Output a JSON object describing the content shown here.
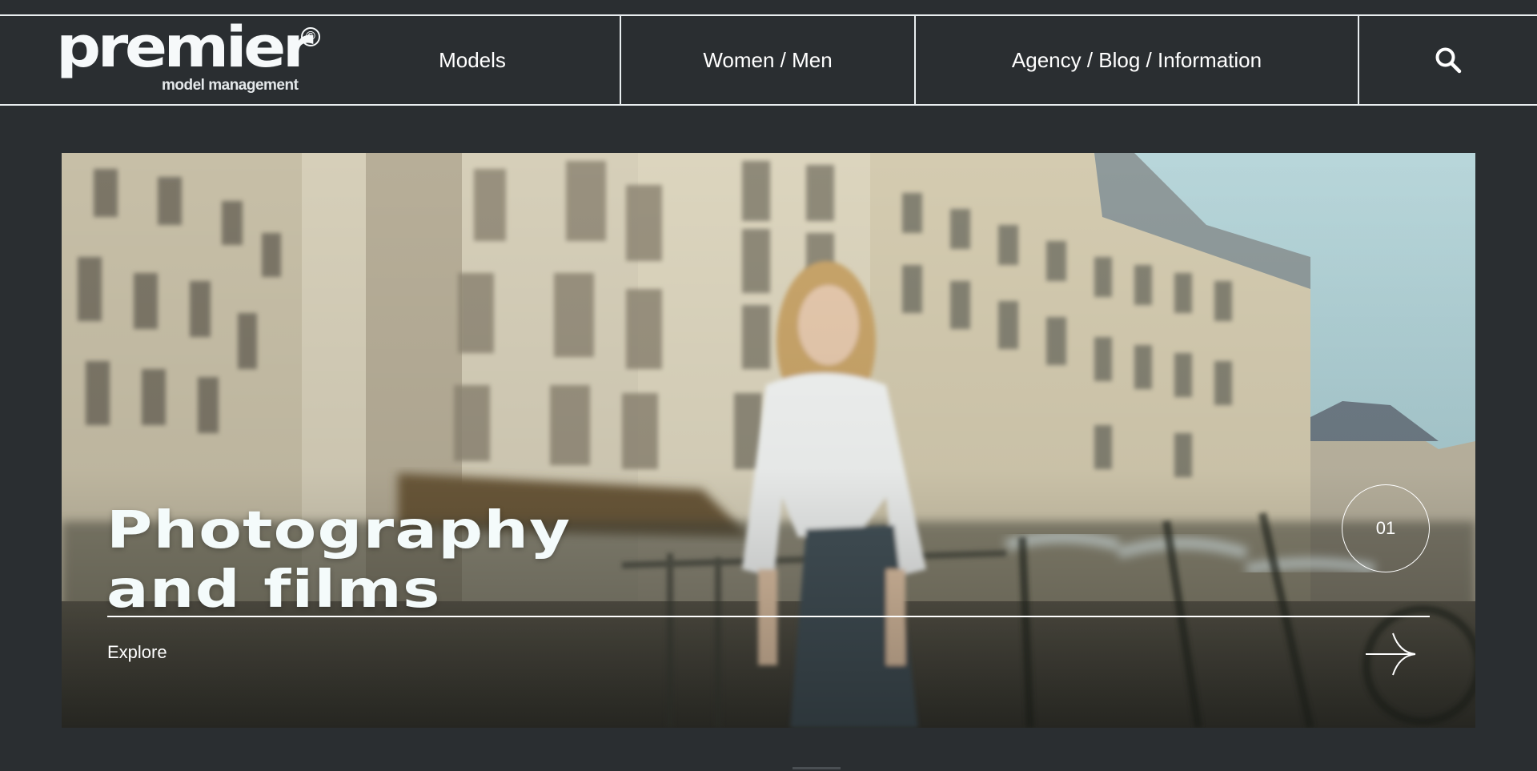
{
  "brand": {
    "name": "premier",
    "mark": "©",
    "tagline": "model management"
  },
  "nav": {
    "items": [
      {
        "label": "Models"
      },
      {
        "label": "Women / Men"
      },
      {
        "label": "Agency / Blog / Information"
      }
    ],
    "search_icon": "search-icon"
  },
  "hero": {
    "title_line1": "Photography",
    "title_line2": "and films",
    "slide_number": "01",
    "cta_label": "Explore",
    "cta_icon": "arrow-right-icon"
  },
  "colors": {
    "background": "#2a2e31",
    "text": "#ffffff",
    "border": "#e9eef0"
  }
}
